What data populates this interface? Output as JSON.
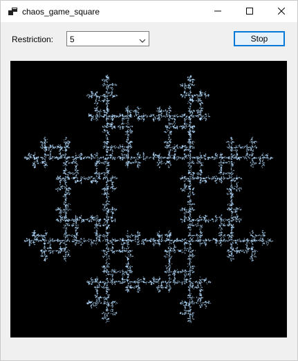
{
  "window": {
    "title": "chaos_game_square",
    "icon": "app-window-icon",
    "controls": [
      "minimize-icon",
      "maximize-icon",
      "close-icon"
    ]
  },
  "toolbar": {
    "restriction_label": "Restriction:",
    "restriction_value": "5",
    "action_button_label": "Stop"
  },
  "canvas": {
    "background_color": "#000000",
    "point_color": "#b5dcff",
    "rule": "chaos game square with restriction 5"
  }
}
